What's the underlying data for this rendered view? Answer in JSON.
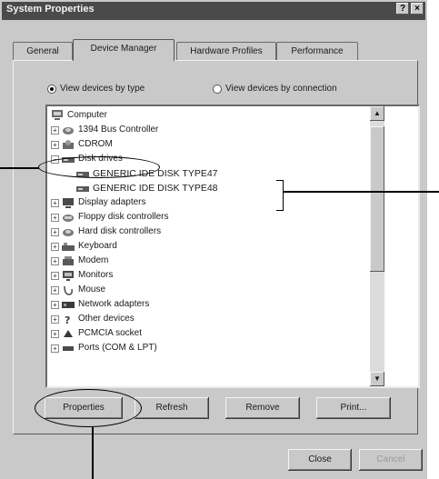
{
  "window": {
    "title": "System Properties",
    "help_label": "?",
    "close_label": "×"
  },
  "tabs": [
    {
      "label": "General"
    },
    {
      "label": "Device Manager"
    },
    {
      "label": "Hardware Profiles"
    },
    {
      "label": "Performance"
    }
  ],
  "view_options": {
    "by_type_label": "View devices by type",
    "by_connection_label": "View devices by connection",
    "selected": "by_type"
  },
  "tree": {
    "root": "Computer",
    "items": [
      {
        "label": "1394 Bus Controller",
        "icon": "bus-controller-icon",
        "expander": "+"
      },
      {
        "label": "CDROM",
        "icon": "cdrom-icon",
        "expander": "+"
      },
      {
        "label": "Disk drives",
        "icon": "disk-drive-icon",
        "expander": "−"
      },
      {
        "label": "GENERIC IDE  DISK TYPE47",
        "icon": "disk-drive-icon",
        "child": true
      },
      {
        "label": "GENERIC IDE  DISK TYPE48",
        "icon": "disk-drive-icon",
        "child": true
      },
      {
        "label": "Display adapters",
        "icon": "display-adapter-icon",
        "expander": "+"
      },
      {
        "label": "Floppy disk controllers",
        "icon": "floppy-controller-icon",
        "expander": "+"
      },
      {
        "label": "Hard disk controllers",
        "icon": "hard-disk-controller-icon",
        "expander": "+"
      },
      {
        "label": "Keyboard",
        "icon": "keyboard-icon",
        "expander": "+"
      },
      {
        "label": "Modem",
        "icon": "modem-icon",
        "expander": "+"
      },
      {
        "label": "Monitors",
        "icon": "monitor-icon",
        "expander": "+"
      },
      {
        "label": "Mouse",
        "icon": "mouse-icon",
        "expander": "+"
      },
      {
        "label": "Network adapters",
        "icon": "network-adapter-icon",
        "expander": "+"
      },
      {
        "label": "Other devices",
        "icon": "other-devices-icon",
        "expander": "+"
      },
      {
        "label": "PCMCIA socket",
        "icon": "pcmcia-socket-icon",
        "expander": "+"
      },
      {
        "label": "Ports (COM & LPT)",
        "icon": "ports-icon",
        "expander": "+"
      }
    ]
  },
  "buttons": {
    "properties": "Properties",
    "refresh": "Refresh",
    "remove": "Remove",
    "print": "Print...",
    "close": "Close",
    "cancel": "Cancel"
  },
  "colors": {
    "titlebar": "#4a4a4a",
    "face": "#c9c9c9",
    "list_bg": "#ffffff"
  }
}
